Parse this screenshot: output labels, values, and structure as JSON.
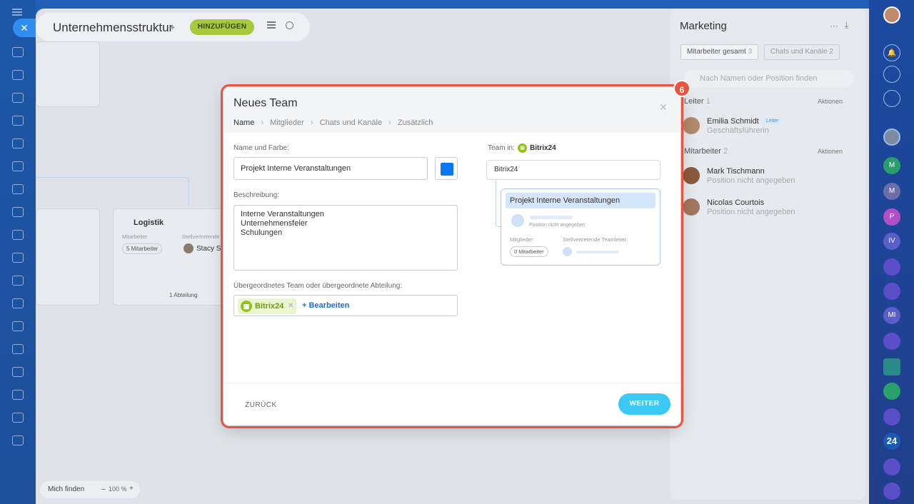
{
  "header": {
    "title": "Unternehmensstruktur",
    "add_button": "HINZUFÜGEN"
  },
  "background": {
    "logistik_title": "Logistik",
    "mitarbeiter_label": "Mitarbeiter",
    "stellvertretende_label": "Stellvertretende",
    "employees_count": "5 Mitarbeiter",
    "deputy_name": "Stacy Sl",
    "abteilung": "1 Abteilung",
    "find_me": "Mich finden",
    "zoom": "100 %"
  },
  "right_panel": {
    "title": "Marketing",
    "tab_employees": "Mitarbeiter gesamt",
    "tab_employees_count": "3",
    "tab_chats": "Chats und Kanäle",
    "tab_chats_count": "2",
    "search_placeholder": "Nach Namen oder Position finden",
    "section_leader": "Leiter",
    "section_leader_count": "1",
    "actions": "Aktionen",
    "leader": {
      "name": "Emilia Schmidt",
      "badge": "Leiter",
      "role": "Geschäftsführerin"
    },
    "section_employees": "Mitarbeiter",
    "section_employees_count": "2",
    "employees": [
      {
        "name": "Mark Tischmann",
        "role": "Position nicht angegeben"
      },
      {
        "name": "Nicolas Courtois",
        "role": "Position nicht angegeben"
      }
    ]
  },
  "modal": {
    "title": "Neues Team",
    "breadcrumbs": [
      "Name",
      "Mitglieder",
      "Chats und Kanäle",
      "Zusätzlich"
    ],
    "name_label": "Name und Farbe:",
    "name_value": "Projekt Interne Veranstaltungen",
    "color": "#0a78f0",
    "description_label": "Beschreibung:",
    "description_lines": [
      "Interne Veranstaltungen",
      "Unternehmensfeier",
      "Schulungen"
    ],
    "parent_label": "Übergeordnetes Team oder übergeordnete Abteilung:",
    "parent_tag": "Bitrix24",
    "edit_link": "+ Bearbeiten",
    "team_in_label": "Team in:",
    "team_in_name": "Bitrix24",
    "preview_root": "Bitrix24",
    "preview_title": "Projekt Interne Veranstaltungen",
    "preview_position": "Position nicht angegeben",
    "preview_members_label": "Mitglieder:",
    "preview_deputy_label": "Stellvertretende Teamleiter:",
    "preview_members_count": "0 Mitarbeiter",
    "back_button": "ZURÜCK",
    "next_button": "WEITER"
  },
  "step_badge": "6",
  "right_bar_badge": "24"
}
